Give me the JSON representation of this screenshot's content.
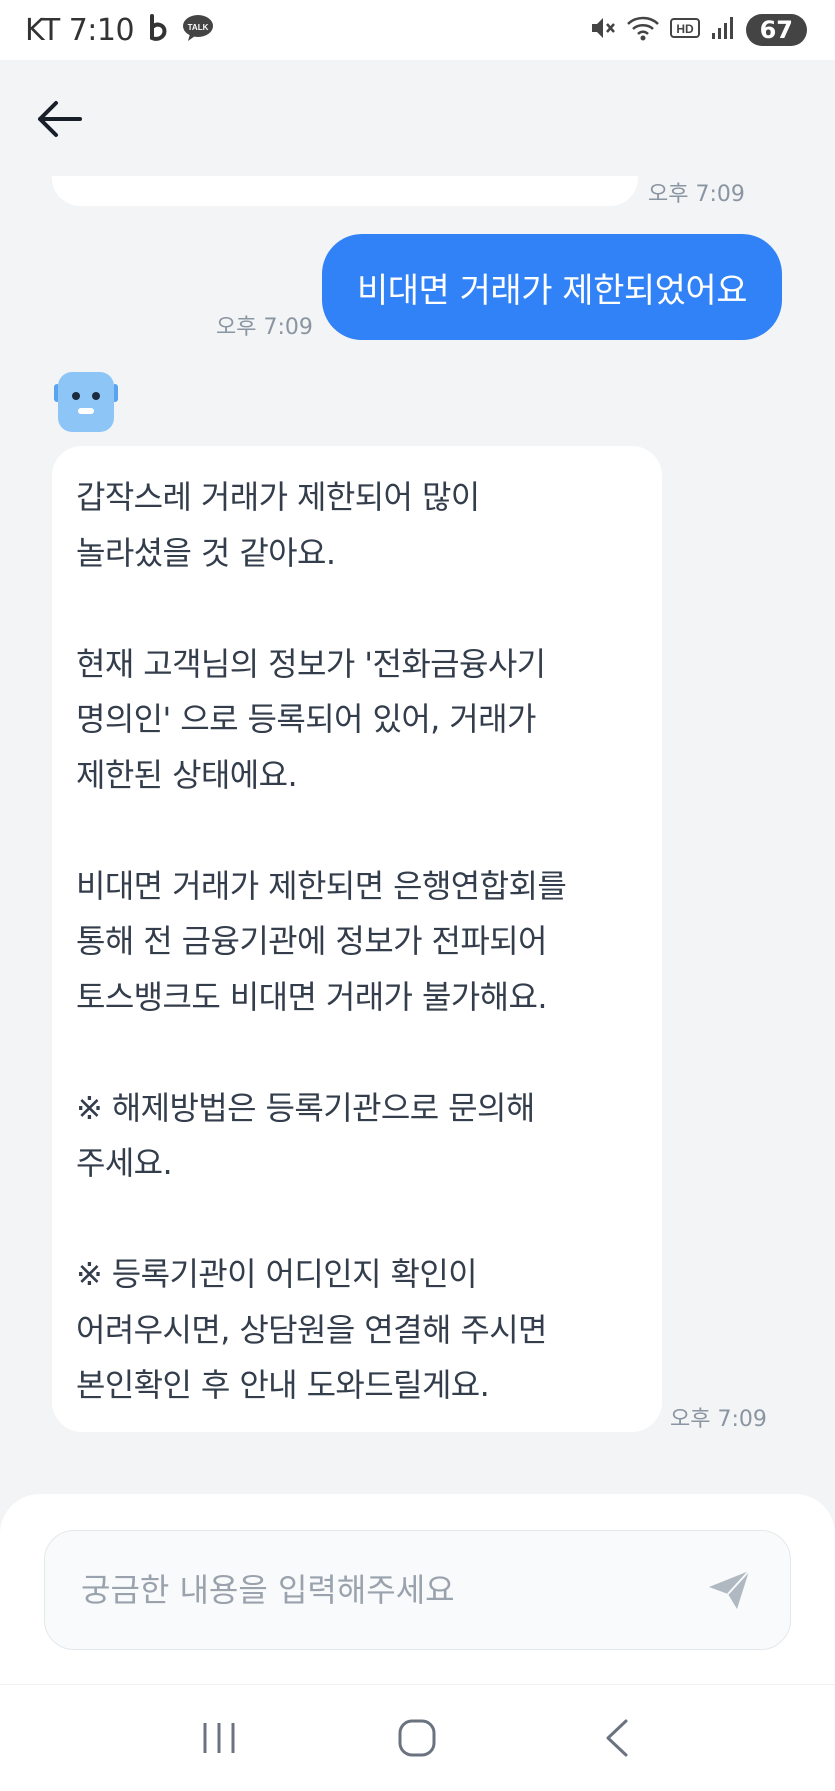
{
  "status_bar": {
    "carrier_time": "KT 7:10",
    "battery": "67",
    "icons": [
      "b-app-icon",
      "kakaotalk-icon",
      "mute-icon",
      "wifi-icon",
      "hd-icon",
      "signal-icon"
    ],
    "talk_label": "TALK",
    "hd_label": "HD"
  },
  "header": {
    "back_icon": "arrow-left-icon"
  },
  "chat": {
    "previous_timestamp": "오후 7:09",
    "user_message": {
      "text": "비대면 거래가 제한되었어요",
      "timestamp": "오후 7:09"
    },
    "bot_message": {
      "avatar_icon": "robot-icon",
      "text": "갑작스레 거래가 제한되어 많이\n놀라셨을 것 같아요.\n\n현재 고객님의 정보가 '전화금융사기\n명의인' 으로 등록되어 있어, 거래가\n제한된 상태에요.\n\n비대면 거래가 제한되면 은행연합회를\n통해 전 금융기관에 정보가 전파되어\n토스뱅크도 비대면 거래가 불가해요.\n\n※ 해제방법은 등록기관으로 문의해\n주세요.\n\n※ 등록기관이 어디인지 확인이\n어려우시면, 상담원을 연결해 주시면\n본인확인 후 안내 도와드릴게요.",
      "timestamp": "오후 7:09"
    }
  },
  "input": {
    "placeholder": "궁금한 내용을 입력해주세요",
    "value": "",
    "send_icon": "send-icon"
  },
  "nav_bar": {
    "icons": [
      "recent-apps-icon",
      "home-icon",
      "back-icon"
    ]
  },
  "colors": {
    "accent": "#3182f6",
    "background": "#f2f4f6",
    "bubble": "#ffffff",
    "timestamp": "#8b95a1",
    "avatar": "#8ec5f7"
  }
}
